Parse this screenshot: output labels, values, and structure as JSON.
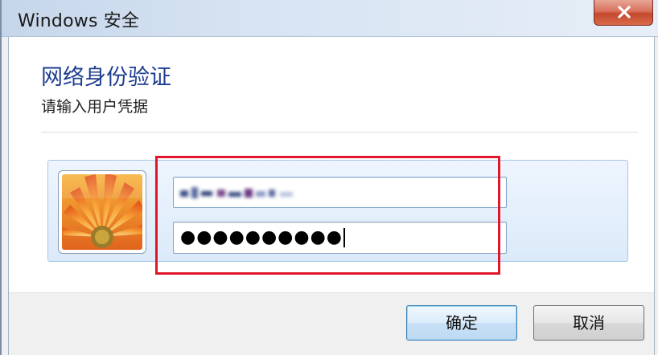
{
  "window": {
    "title": "Windows 安全",
    "close_icon": "close-icon"
  },
  "dialog": {
    "heading": "网络身份验证",
    "subheading": "请输入用户凭据"
  },
  "credentials": {
    "avatar_icon": "user-avatar-flower-icon",
    "username_value": "",
    "password_masked": "●●●●●●●●●●"
  },
  "buttons": {
    "ok_label": "确定",
    "cancel_label": "取消"
  },
  "colors": {
    "accent_heading": "#1e3d8f",
    "highlight_border": "#e0162a",
    "close_button": "#c4492f"
  }
}
